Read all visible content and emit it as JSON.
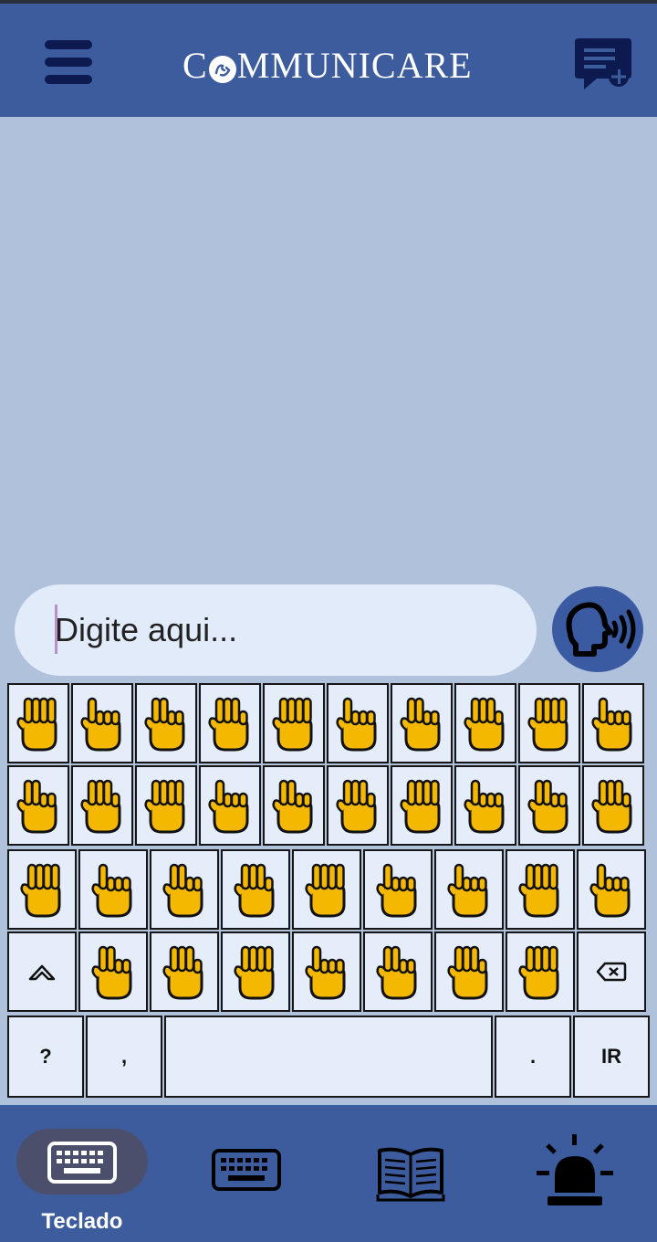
{
  "header": {
    "brand_name": "COMMUNICARE",
    "brand_prefix": "C",
    "brand_suffix": "MMUNICARE",
    "menu_icon": "hamburger-menu-icon",
    "new_chat_icon": "new-message-icon"
  },
  "composer": {
    "placeholder": "Digite aqui...",
    "value": "",
    "speak_icon": "speaking-head-icon"
  },
  "keyboard": {
    "rows": [
      [
        "hand-sign-a",
        "hand-sign-b",
        "hand-sign-c",
        "hand-sign-d",
        "hand-sign-e",
        "hand-sign-f",
        "hand-sign-g",
        "hand-sign-h",
        "hand-sign-i",
        "hand-sign-j"
      ],
      [
        "hand-sign-k",
        "hand-sign-l",
        "hand-sign-m",
        "hand-sign-n",
        "hand-sign-o",
        "hand-sign-p",
        "hand-sign-q",
        "hand-sign-r",
        "hand-sign-s",
        "hand-sign-t"
      ],
      [
        "hand-sign-u",
        "hand-sign-v",
        "hand-sign-w",
        "hand-sign-x",
        "hand-sign-y",
        "hand-sign-z",
        "hand-sign-c-cedilla",
        "hand-sign-1",
        "hand-sign-2"
      ],
      [
        "shift-icon",
        "hand-sign-3",
        "hand-sign-4",
        "hand-sign-5",
        "hand-sign-6",
        "hand-sign-7",
        "hand-sign-8",
        "hand-sign-9",
        "backspace-icon"
      ]
    ],
    "bottom_row": {
      "question": "?",
      "comma": ",",
      "space": "",
      "period": ".",
      "go": "IR"
    },
    "hand_color": "#f5b800",
    "key_color": "#e4edf9"
  },
  "bottom_nav": {
    "items": [
      {
        "icon": "keyboard-icon",
        "label": "Teclado",
        "active": true
      },
      {
        "icon": "keyboard-outline-icon",
        "label": "",
        "active": false
      },
      {
        "icon": "book-icon",
        "label": "",
        "active": false
      },
      {
        "icon": "alarm-siren-icon",
        "label": "",
        "active": false
      }
    ]
  },
  "colors": {
    "header_bg": "#3d5c9e",
    "chat_bg": "#b0c1dc",
    "accent": "#0c1a4f"
  }
}
